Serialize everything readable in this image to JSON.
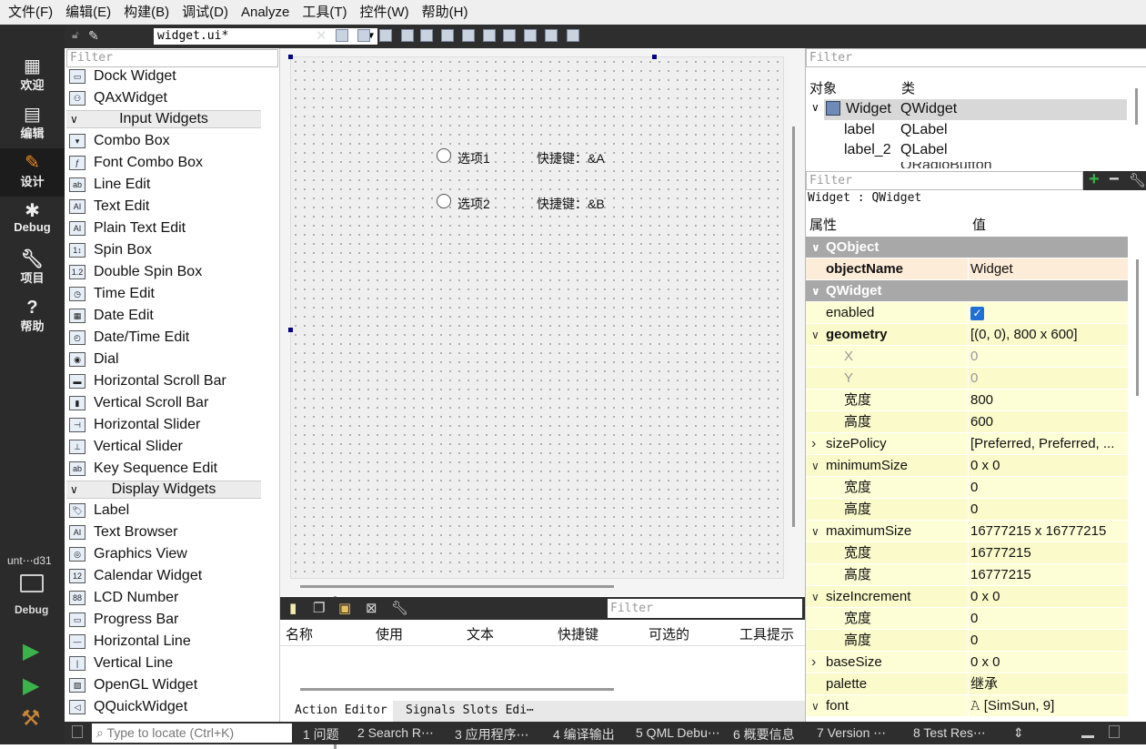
{
  "menu": [
    "文件(F)",
    "编辑(E)",
    "构建(B)",
    "调试(D)",
    "Analyze",
    "工具(T)",
    "控件(W)",
    "帮助(H)"
  ],
  "modes": [
    {
      "label": "欢迎",
      "icon": "grid-icon"
    },
    {
      "label": "编辑",
      "icon": "document-icon"
    },
    {
      "label": "设计",
      "icon": "pencil-icon"
    },
    {
      "label": "Debug",
      "icon": "bug-icon"
    },
    {
      "label": "项目",
      "icon": "wrench-icon"
    },
    {
      "label": "帮助",
      "icon": "help-icon"
    }
  ],
  "kit": {
    "name": "unt⋯d31",
    "mode": "Debug"
  },
  "editor": {
    "file": "widget.ui*"
  },
  "widgetbox": {
    "filter_placeholder": "Filter",
    "items_top": [
      "Dock Widget",
      "QAxWidget"
    ],
    "cat_input": "Input Widgets",
    "input_items": [
      "Combo Box",
      "Font Combo Box",
      "Line Edit",
      "Text Edit",
      "Plain Text Edit",
      "Spin Box",
      "Double Spin Box",
      "Time Edit",
      "Date Edit",
      "Date/Time Edit",
      "Dial",
      "Horizontal Scroll Bar",
      "Vertical Scroll Bar",
      "Horizontal Slider",
      "Vertical Slider",
      "Key Sequence Edit"
    ],
    "cat_display": "Display Widgets",
    "display_items": [
      "Label",
      "Text Browser",
      "Graphics View",
      "Calendar Widget",
      "LCD Number",
      "Progress Bar",
      "Horizontal Line",
      "Vertical Line",
      "OpenGL Widget",
      "QQuickWidget"
    ]
  },
  "form": {
    "radio1": "选项1",
    "label1": "快捷键：&A",
    "radio2": "选项2",
    "label2": "快捷键：&B"
  },
  "actions": {
    "filter_placeholder": "Filter",
    "headers": [
      "名称",
      "使用",
      "文本",
      "快捷键",
      "可选的",
      "工具提示"
    ],
    "tabs": [
      "Action Editor",
      "Signals  Slots Edi⋯"
    ]
  },
  "statusbar": {
    "locate_placeholder": "Type to locate (Ctrl+K)",
    "items": [
      "1 问题",
      "2 Search R⋯",
      "3 应用程序⋯",
      "4 编译输出",
      "5 QML Debu⋯",
      "6 概要信息",
      "7 Version ⋯",
      "8 Test Res⋯"
    ]
  },
  "objects": {
    "filter_placeholder": "Filter",
    "headers": [
      "对象",
      "类"
    ],
    "rows": [
      {
        "obj": "Widget",
        "cls": "QWidget"
      },
      {
        "obj": "label",
        "cls": "QLabel"
      },
      {
        "obj": "label_2",
        "cls": "QLabel"
      },
      {
        "obj": "",
        "cls": "QRadioButton"
      }
    ]
  },
  "properties": {
    "filter_placeholder": "Filter",
    "context": "Widget : QWidget",
    "headers": [
      "属性",
      "值"
    ],
    "rows": [
      {
        "name": "QObject",
        "value": "",
        "type": "group"
      },
      {
        "name": "objectName",
        "value": "Widget",
        "type": "obj"
      },
      {
        "name": "QWidget",
        "value": "",
        "type": "group"
      },
      {
        "name": "enabled",
        "value": "",
        "type": "check"
      },
      {
        "name": "geometry",
        "value": "[(0, 0), 800 x 600]",
        "type": "bold"
      },
      {
        "name": "X",
        "value": "0",
        "type": "dis"
      },
      {
        "name": "Y",
        "value": "0",
        "type": "dis"
      },
      {
        "name": "宽度",
        "value": "800",
        "type": "sub"
      },
      {
        "name": "高度",
        "value": "600",
        "type": "sub"
      },
      {
        "name": "sizePolicy",
        "value": "[Preferred, Preferred, ...",
        "type": "collapsed"
      },
      {
        "name": "minimumSize",
        "value": "0 x 0",
        "type": "expanded"
      },
      {
        "name": "宽度",
        "value": "0",
        "type": "sub"
      },
      {
        "name": "高度",
        "value": "0",
        "type": "sub"
      },
      {
        "name": "maximumSize",
        "value": "16777215 x 16777215",
        "type": "expanded"
      },
      {
        "name": "宽度",
        "value": "16777215",
        "type": "sub"
      },
      {
        "name": "高度",
        "value": "16777215",
        "type": "sub"
      },
      {
        "name": "sizeIncrement",
        "value": "0 x 0",
        "type": "expanded"
      },
      {
        "name": "宽度",
        "value": "0",
        "type": "sub"
      },
      {
        "name": "高度",
        "value": "0",
        "type": "sub"
      },
      {
        "name": "baseSize",
        "value": "0 x 0",
        "type": "collapsed"
      },
      {
        "name": "palette",
        "value": "继承",
        "type": "plain"
      },
      {
        "name": "font",
        "value": "𝙰  [SimSun, 9]",
        "type": "expanded"
      }
    ]
  }
}
